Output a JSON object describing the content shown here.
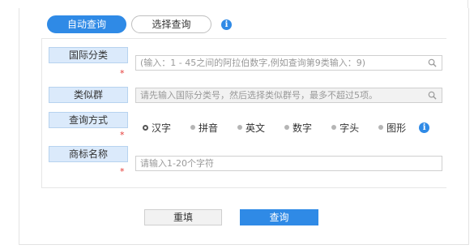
{
  "tabs": {
    "auto": "自动查询",
    "select": "选择查询",
    "info_icon": "i"
  },
  "form": {
    "intl_class": {
      "label": "国际分类",
      "required_mark": "*",
      "placeholder": "(输入：1 - 45之间的阿拉伯数字,例如查询第9类输入：9)",
      "search_icon": "search-icon"
    },
    "similar_group": {
      "label": "类似群",
      "placeholder": "请先输入国际分类号，然后选择类似群号，最多不超过5项。",
      "search_icon": "search-icon"
    },
    "query_method": {
      "label": "查询方式",
      "required_mark": "*",
      "options": [
        "汉字",
        "拼音",
        "英文",
        "数字",
        "字头",
        "图形"
      ],
      "selected": "汉字",
      "info_icon": "i"
    },
    "trademark_name": {
      "label": "商标名称",
      "required_mark": "*",
      "placeholder": "请输入1-20个字符"
    }
  },
  "buttons": {
    "reset": "重填",
    "query": "查询"
  },
  "colors": {
    "accent": "#2f8ae6",
    "label_bg": "#dbeafb",
    "required": "#e53935"
  }
}
